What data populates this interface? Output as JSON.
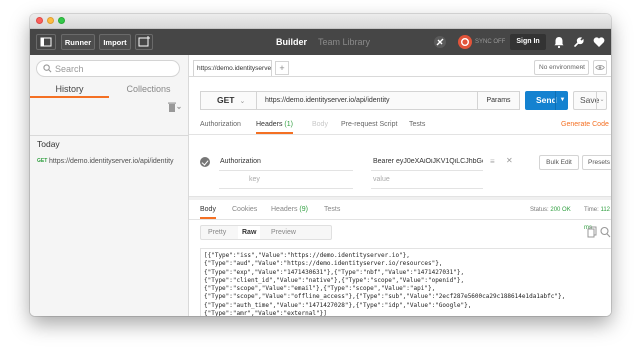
{
  "header": {
    "runner_label": "Runner",
    "import_label": "Import",
    "builder_label": "Builder",
    "team_library_label": "Team Library",
    "sync_label": "SYNC OFF",
    "signin_label": "Sign In"
  },
  "sidebar": {
    "search_placeholder": "Search",
    "tabs": {
      "history": "History",
      "collections": "Collections"
    },
    "group_label": "Today",
    "items": [
      {
        "method": "GET",
        "url": "https://demo.identityserver.io/api/identity"
      }
    ]
  },
  "request": {
    "tab_label": "https://demo.identityserver.",
    "plus_label": "+",
    "environment": "No environment",
    "method": "GET",
    "url": "https://demo.identityserver.io/api/identity",
    "params_label": "Params",
    "send_label": "Send",
    "save_label": "Save",
    "subtabs": {
      "authorization": "Authorization",
      "headers": "Headers",
      "headers_count": "(1)",
      "body": "Body",
      "prerequest": "Pre-request Script",
      "tests": "Tests",
      "generate_code": "Generate Code"
    },
    "header_rows": [
      {
        "key": "Authorization",
        "value": "Bearer eyJ0eXAiOiJKV1QiLCJhbGciO"
      }
    ],
    "key_placeholder": "key",
    "value_placeholder": "value",
    "bulk_edit_label": "Bulk Edit",
    "presets_label": "Presets"
  },
  "response": {
    "tabs": {
      "body": "Body",
      "cookies": "Cookies",
      "headers": "Headers",
      "headers_count": "(9)",
      "tests": "Tests"
    },
    "status_label": "Status:",
    "status_value": "200 OK",
    "time_label": "Time:",
    "time_value": "112 ms",
    "view_tabs": {
      "pretty": "Pretty",
      "raw": "Raw",
      "preview": "Preview"
    },
    "body_text": "[{\"Type\":\"iss\",\"Value\":\"https://demo.identityserver.io\"},\n{\"Type\":\"aud\",\"Value\":\"https://demo.identityserver.io/resources\"},\n{\"Type\":\"exp\",\"Value\":\"1471430631\"},{\"Type\":\"nbf\",\"Value\":\"1471427031\"},\n{\"Type\":\"client_id\",\"Value\":\"native\"},{\"Type\":\"scope\",\"Value\":\"openid\"},\n{\"Type\":\"scope\",\"Value\":\"email\"},{\"Type\":\"scope\",\"Value\":\"api\"},\n{\"Type\":\"scope\",\"Value\":\"offline_access\"},{\"Type\":\"sub\",\"Value\":\"2ecf287e5600ca29c188614e1da1abfc\"},\n{\"Type\":\"auth_time\",\"Value\":\"1471427028\"},{\"Type\":\"idp\",\"Value\":\"Google\"},\n{\"Type\":\"amr\",\"Value\":\"external\"}]"
  },
  "colors": {
    "accent": "#f47023",
    "send_blue": "#1482d0",
    "success_green": "#2e9e3e",
    "header_dark": "#464646"
  }
}
